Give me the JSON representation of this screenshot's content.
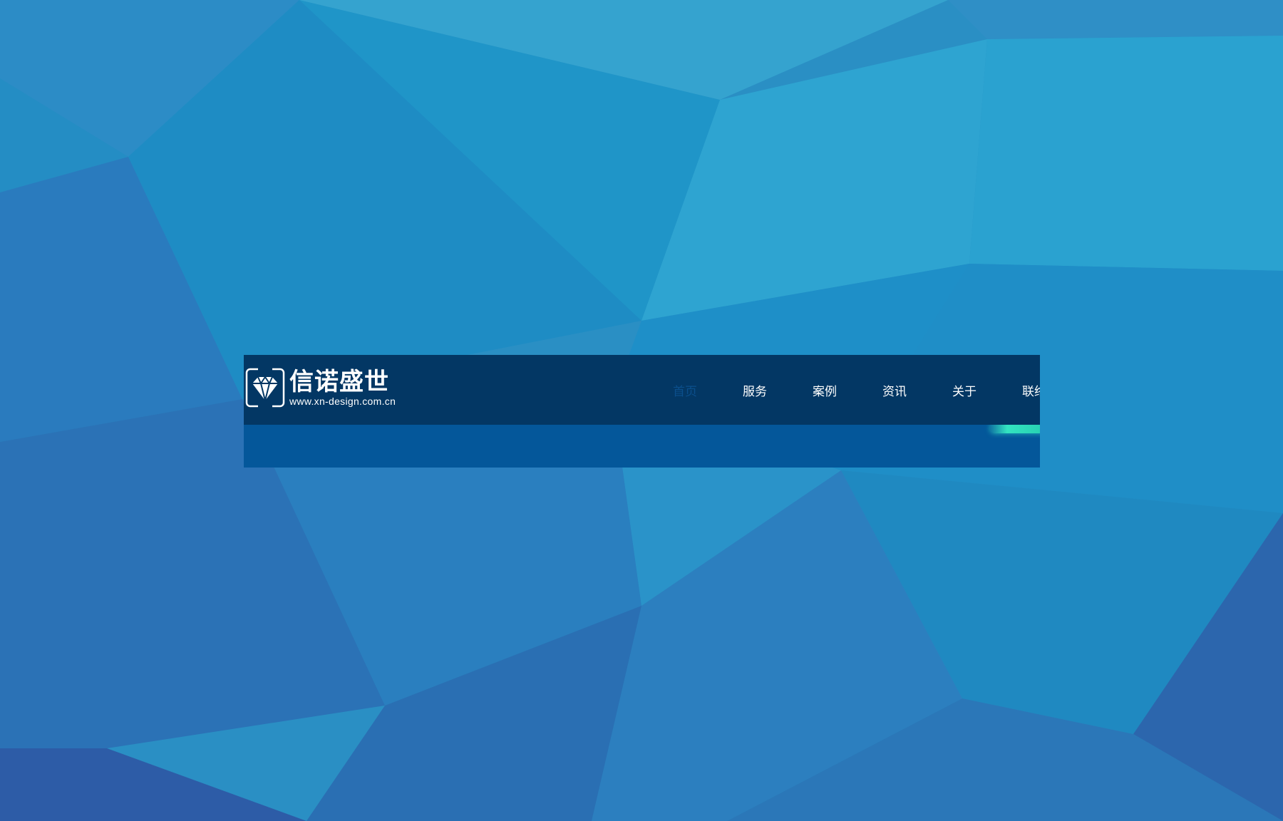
{
  "brand": {
    "name": "信诺盛世",
    "url": "www.xn-design.com.cn",
    "logo_icon": "diamond-icon"
  },
  "nav": {
    "items": [
      {
        "label": "首页",
        "active": true
      },
      {
        "label": "服务",
        "active": false
      },
      {
        "label": "案例",
        "active": false
      },
      {
        "label": "资讯",
        "active": false
      },
      {
        "label": "关于",
        "active": false
      },
      {
        "label": "联络",
        "active": false
      }
    ]
  },
  "colors": {
    "page_background": "#2a8fc4",
    "header_background": "#033764",
    "subbar_background": "#04579a",
    "nav_text": "#ffffff",
    "nav_active_text": "#0b4f8c",
    "accent_glow": "#33e3c0"
  }
}
